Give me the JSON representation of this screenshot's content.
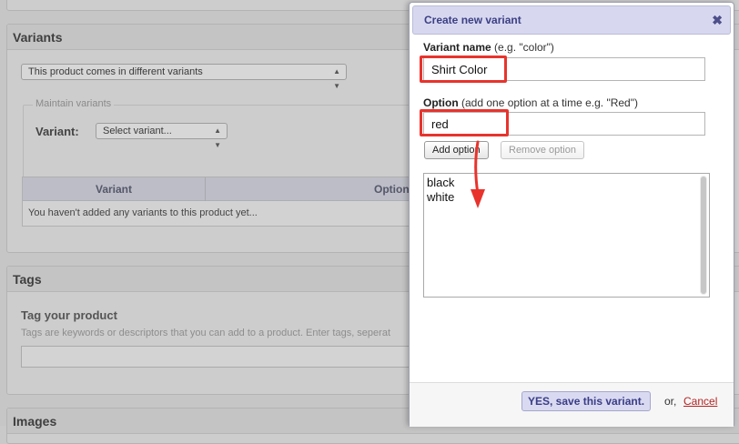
{
  "background": {
    "variants": {
      "heading": "Variants",
      "mode_select": "This product comes in different variants",
      "maintain_legend": "Maintain variants",
      "variant_label": "Variant:",
      "variant_select": "Select variant...",
      "table_headers": [
        "Variant",
        "Option"
      ],
      "empty_text": "You haven't added any variants to this product yet..."
    },
    "tags": {
      "heading": "Tags",
      "title": "Tag your product",
      "description": "Tags are keywords or descriptors that you can add to a product. Enter tags, seperat"
    },
    "images": {
      "heading": "Images"
    }
  },
  "dialog": {
    "title": "Create new variant",
    "close_glyph": "✖",
    "variant_name_label": "Variant name",
    "variant_name_hint": "(e.g. \"color\")",
    "variant_name_value": "Shirt Color",
    "option_label": "Option",
    "option_hint": "(add one option at a time e.g. \"Red\")",
    "option_value": "red",
    "add_option_button": "Add option",
    "remove_option_button": "Remove option",
    "options_list": [
      "black",
      "white"
    ],
    "save_button": "YES, save this variant.",
    "or_text": "or,",
    "cancel_link": "Cancel"
  },
  "annotation_color": "#e8332c"
}
